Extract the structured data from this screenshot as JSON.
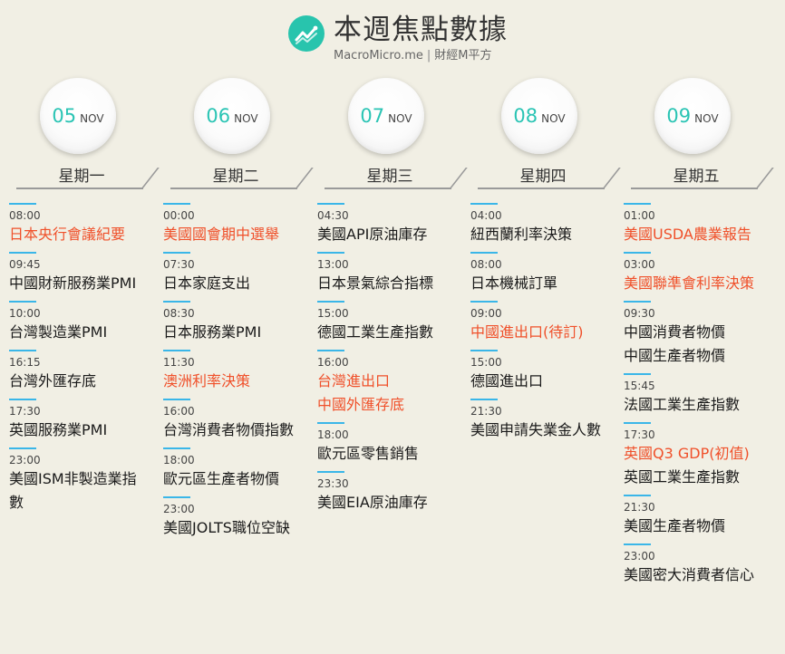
{
  "header": {
    "title": "本週焦點數據",
    "brand": "MacroMicro.me",
    "sep": "|",
    "tagline": "財經M平方"
  },
  "colors": {
    "accent": "#2ac4b4",
    "highlight": "#f0502a",
    "bar": "#3ab6e8",
    "logo": "#28c4ad"
  },
  "days": [
    {
      "date": "05",
      "month": "NOV",
      "weekday": "星期一",
      "events": [
        {
          "time": "08:00",
          "lines": [
            "日本央行會議紀要"
          ],
          "highlight": true
        },
        {
          "time": "09:45",
          "lines": [
            "中國財新服務業PMI"
          ],
          "highlight": false
        },
        {
          "time": "10:00",
          "lines": [
            "台灣製造業PMI"
          ],
          "highlight": false
        },
        {
          "time": "16:15",
          "lines": [
            "台灣外匯存底"
          ],
          "highlight": false
        },
        {
          "time": "17:30",
          "lines": [
            "英國服務業PMI"
          ],
          "highlight": false
        },
        {
          "time": "23:00",
          "lines": [
            "美國ISM非製造業指",
            "數"
          ],
          "highlight": false
        }
      ]
    },
    {
      "date": "06",
      "month": "NOV",
      "weekday": "星期二",
      "events": [
        {
          "time": "00:00",
          "lines": [
            "美國國會期中選舉"
          ],
          "highlight": true
        },
        {
          "time": "07:30",
          "lines": [
            "日本家庭支出"
          ],
          "highlight": false
        },
        {
          "time": "08:30",
          "lines": [
            "日本服務業PMI"
          ],
          "highlight": false
        },
        {
          "time": "11:30",
          "lines": [
            "澳洲利率決策"
          ],
          "highlight": true
        },
        {
          "time": "16:00",
          "lines": [
            "台灣消費者物價指數"
          ],
          "highlight": false
        },
        {
          "time": "18:00",
          "lines": [
            "歐元區生產者物價"
          ],
          "highlight": false
        },
        {
          "time": "23:00",
          "lines": [
            "美國JOLTS職位空缺"
          ],
          "highlight": false
        }
      ]
    },
    {
      "date": "07",
      "month": "NOV",
      "weekday": "星期三",
      "events": [
        {
          "time": "04:30",
          "lines": [
            "美國API原油庫存"
          ],
          "highlight": false
        },
        {
          "time": "13:00",
          "lines": [
            "日本景氣綜合指標"
          ],
          "highlight": false
        },
        {
          "time": "15:00",
          "lines": [
            "德國工業生產指數"
          ],
          "highlight": false
        },
        {
          "time": "16:00",
          "lines": [
            "台灣進出口",
            "中國外匯存底"
          ],
          "highlight": true
        },
        {
          "time": "18:00",
          "lines": [
            "歐元區零售銷售"
          ],
          "highlight": false
        },
        {
          "time": "23:30",
          "lines": [
            "美國EIA原油庫存"
          ],
          "highlight": false
        }
      ]
    },
    {
      "date": "08",
      "month": "NOV",
      "weekday": "星期四",
      "events": [
        {
          "time": "04:00",
          "lines": [
            "紐西蘭利率決策"
          ],
          "highlight": false
        },
        {
          "time": "08:00",
          "lines": [
            "日本機械訂單"
          ],
          "highlight": false
        },
        {
          "time": "09:00",
          "lines": [
            "中國進出口(待訂)"
          ],
          "highlight": true
        },
        {
          "time": "15:00",
          "lines": [
            "德國進出口"
          ],
          "highlight": false
        },
        {
          "time": "21:30",
          "lines": [
            "美國申請失業金人數"
          ],
          "highlight": false
        }
      ]
    },
    {
      "date": "09",
      "month": "NOV",
      "weekday": "星期五",
      "events": [
        {
          "time": "01:00",
          "lines": [
            "美國USDA農業報告"
          ],
          "highlight": true
        },
        {
          "time": "03:00",
          "lines": [
            "美國聯準會利率決策"
          ],
          "highlight": true
        },
        {
          "time": "09:30",
          "lines": [
            "中國消費者物價",
            "中國生產者物價"
          ],
          "highlight": false
        },
        {
          "time": "15:45",
          "lines": [
            "法國工業生產指數"
          ],
          "highlight": false
        },
        {
          "time": "17:30",
          "lines": [
            "英國Q3 GDP(初值)",
            "英國工業生產指數"
          ],
          "highlight": "first"
        },
        {
          "time": "21:30",
          "lines": [
            "美國生產者物價"
          ],
          "highlight": false
        },
        {
          "time": "23:00",
          "lines": [
            "美國密大消費者信心"
          ],
          "highlight": false
        }
      ]
    }
  ]
}
